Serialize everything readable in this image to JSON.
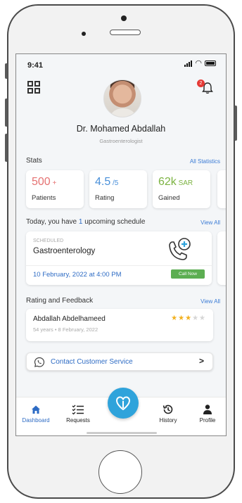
{
  "status_bar": {
    "time": "9:41"
  },
  "notifications": {
    "badge_count": "2"
  },
  "profile": {
    "name": "Dr. Mohamed Abdallah",
    "specialty": "Gastroenterologist"
  },
  "stats": {
    "title": "Stats",
    "all_link": "All Statistics",
    "cards": [
      {
        "value": "500",
        "unit": " +",
        "label": "Patients",
        "color": "#e57373"
      },
      {
        "value": "4.5",
        "unit": " /5",
        "label": "Rating",
        "color": "#4a90d9"
      },
      {
        "value": "62k",
        "unit": " SAR",
        "label": "Gained",
        "color": "#7cb342"
      }
    ]
  },
  "schedule": {
    "title_prefix": "Today, you have ",
    "count": "1",
    "title_suffix": " upcoming schedule",
    "view_all": "View All",
    "card": {
      "tag": "SCHEDULED",
      "title": "Gastroenterology",
      "date": "10 February, 2022 at 4:00 PM",
      "call_label": "Call Now"
    }
  },
  "feedback": {
    "title": "Rating and Feedback",
    "view_all": "View All",
    "item": {
      "name": "Abdallah Abdelhameed",
      "meta": "54 years  •  8 February, 2022",
      "rating": 3,
      "max_rating": 5
    }
  },
  "contact": {
    "label": "Contact Customer Service"
  },
  "tabs": [
    {
      "label": "Dashboard",
      "icon": "home-icon",
      "active": true
    },
    {
      "label": "Requests",
      "icon": "checklist-icon",
      "active": false
    },
    {
      "label": "History",
      "icon": "history-icon",
      "active": false
    },
    {
      "label": "Profile",
      "icon": "user-icon",
      "active": false
    }
  ],
  "colors": {
    "primary": "#2d6bc4",
    "accent": "#2fa3db",
    "call_green": "#5cae52"
  }
}
